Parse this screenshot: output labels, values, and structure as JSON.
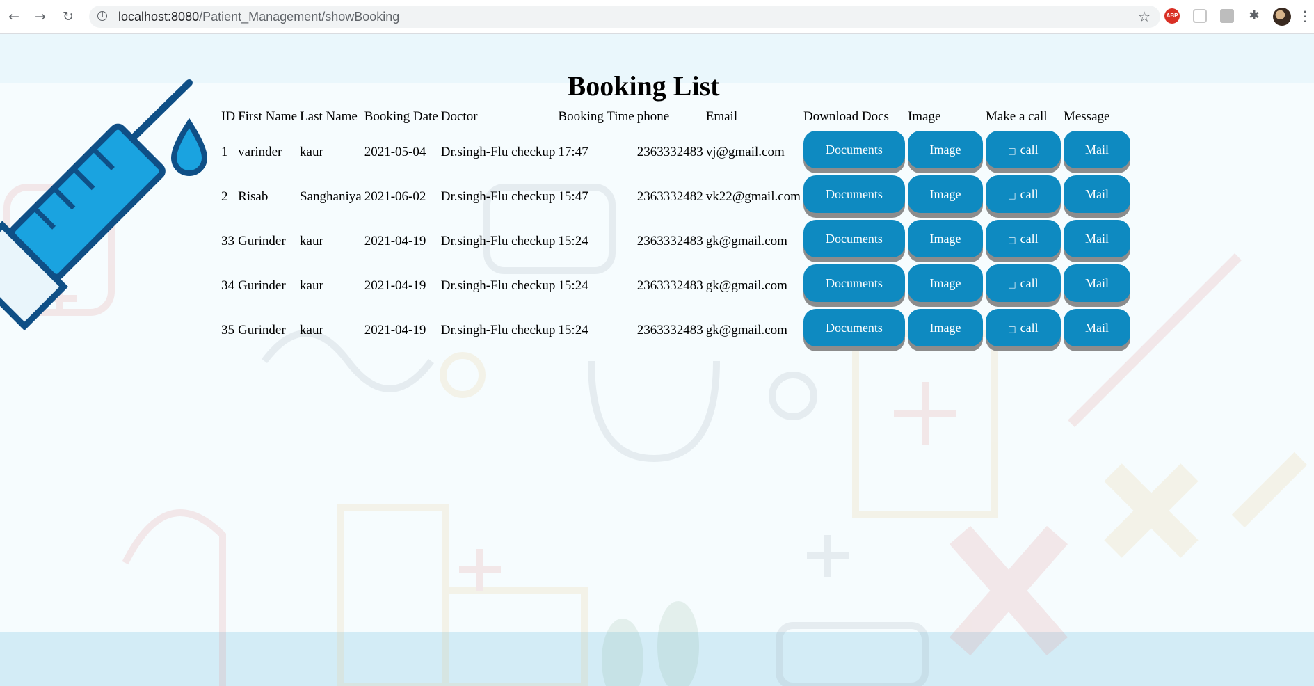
{
  "browser": {
    "url_host": "localhost:8080",
    "url_path": "/Patient_Management/showBooking",
    "abp_label": "ABP"
  },
  "page": {
    "title": "Booking List"
  },
  "table": {
    "headers": [
      "ID",
      "First Name",
      "Last Name",
      "Booking Date",
      "Doctor",
      "Booking Time",
      "phone",
      "Email",
      "Download Docs",
      "Image",
      "Make a call",
      "Message"
    ],
    "rows": [
      {
        "id": "1",
        "first": "varinder",
        "last": "kaur",
        "date": "2021-05-04",
        "doctor": "Dr.singh-Flu checkup",
        "time": "17:47",
        "phone": "2363332483",
        "email": "vj@gmail.com"
      },
      {
        "id": "2",
        "first": "Risab",
        "last": "Sanghaniya",
        "date": "2021-06-02",
        "doctor": "Dr.singh-Flu checkup",
        "time": "15:47",
        "phone": "2363332482",
        "email": "vk22@gmail.com"
      },
      {
        "id": "33",
        "first": "Gurinder",
        "last": "kaur",
        "date": "2021-04-19",
        "doctor": "Dr.singh-Flu checkup",
        "time": "15:24",
        "phone": "2363332483",
        "email": "gk@gmail.com"
      },
      {
        "id": "34",
        "first": "Gurinder",
        "last": "kaur",
        "date": "2021-04-19",
        "doctor": "Dr.singh-Flu checkup",
        "time": "15:24",
        "phone": "2363332483",
        "email": "gk@gmail.com"
      },
      {
        "id": "35",
        "first": "Gurinder",
        "last": "kaur",
        "date": "2021-04-19",
        "doctor": "Dr.singh-Flu checkup",
        "time": "15:24",
        "phone": "2363332483",
        "email": "gk@gmail.com"
      }
    ],
    "buttons": {
      "documents": "Documents",
      "image": "Image",
      "call_glyph": "□",
      "call": "call",
      "mail": "Mail"
    }
  },
  "colors": {
    "button": "#0e8ac1",
    "button_shadow": "#8c8c8c"
  }
}
